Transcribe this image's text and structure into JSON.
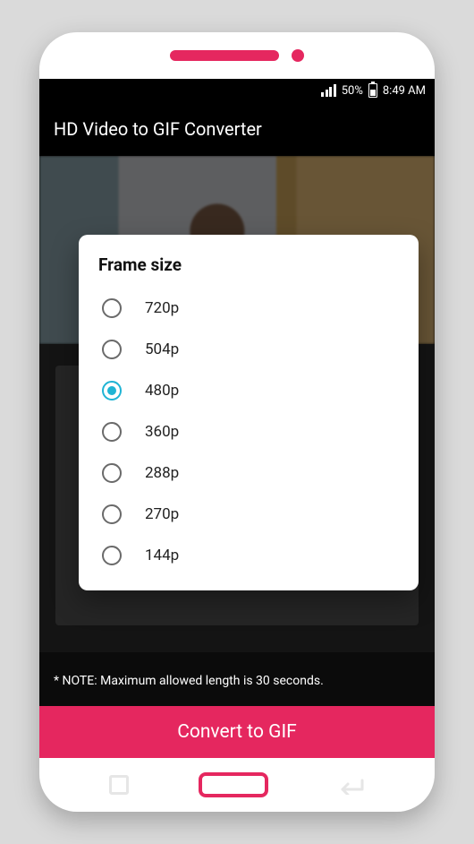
{
  "status": {
    "battery_pct": "50%",
    "time": "8:49 AM"
  },
  "app_title": "HD Video to GIF Converter",
  "dialog": {
    "title": "Frame size",
    "options": [
      {
        "label": "720p",
        "selected": false
      },
      {
        "label": "504p",
        "selected": false
      },
      {
        "label": "480p",
        "selected": true
      },
      {
        "label": "360p",
        "selected": false
      },
      {
        "label": "288p",
        "selected": false
      },
      {
        "label": "270p",
        "selected": false
      },
      {
        "label": "144p",
        "selected": false
      }
    ]
  },
  "note": "* NOTE: Maximum allowed length is 30 seconds.",
  "convert_label": "Convert to GIF",
  "colors": {
    "accent": "#e5275f",
    "radio_selected": "#1fb4d4"
  }
}
